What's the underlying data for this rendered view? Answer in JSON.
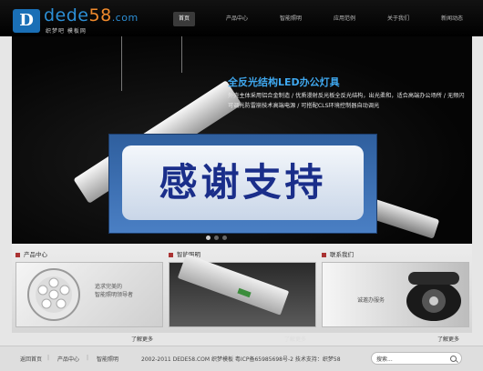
{
  "header": {
    "logo_mark": "D",
    "logo_name": "dede",
    "logo_num": "58",
    "logo_domain": ".com",
    "logo_sub": "织梦吧 模板网",
    "nav": [
      {
        "label": "首页",
        "active": true
      },
      {
        "label": "产品中心",
        "active": false
      },
      {
        "label": "智能照明",
        "active": false
      },
      {
        "label": "应用范例",
        "active": false
      },
      {
        "label": "关于我们",
        "active": false
      },
      {
        "label": "新闻动态",
        "active": false
      }
    ]
  },
  "banner": {
    "title": "全反光结构LED办公灯具",
    "desc": "外壳主体采用铝合金制造 / 优质漫射反光板全反光结构，出光柔和，适合高端办公场所 / 无频闪可调光防雷崩技术高端电源 / 可搭配CLS环境控制器自动调光",
    "overlay_text": "感谢支持"
  },
  "panels": [
    {
      "title": "产品中心",
      "caption": "追求完美的\n智能照明领导者",
      "more": "了解更多"
    },
    {
      "title": "智能照明",
      "caption": "",
      "more": "了解更多"
    },
    {
      "title": "联系我们",
      "caption": "诚邀办服务",
      "more": "了解更多"
    }
  ],
  "footer": {
    "links": [
      "返回首页",
      "产品中心",
      "智能照明"
    ],
    "copyright": "2002-2011 DEDE58.COM 织梦模板 粤ICP备65985698号-2 技术支持：织梦58",
    "search_label": "搜索..."
  }
}
